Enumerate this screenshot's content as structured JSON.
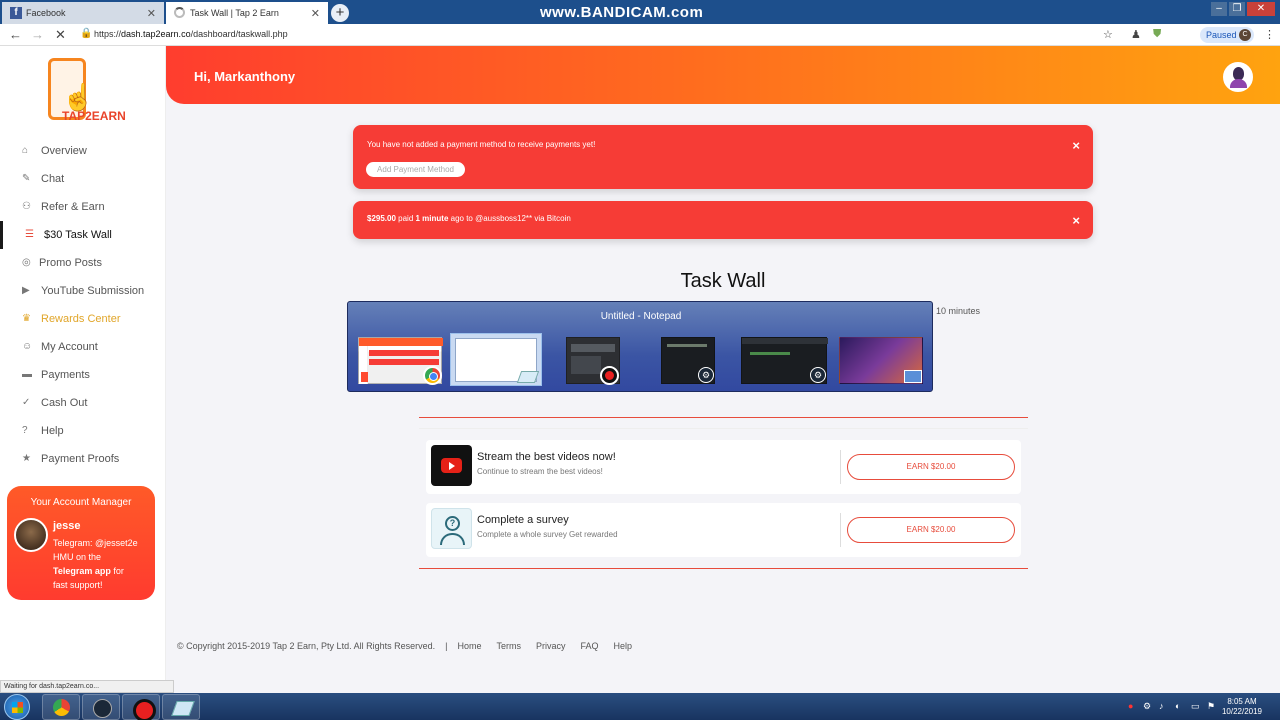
{
  "browser": {
    "tabs": [
      {
        "title": "Facebook"
      },
      {
        "title": "Task Wall | Tap 2 Earn"
      }
    ],
    "new_tab": "+",
    "watermark": "www.BANDICAM.com",
    "url_prefix": "https://",
    "url_host": "dash.tap2earn.co",
    "url_path": "/dashboard/taskwall.php",
    "paused_label": "Paused",
    "profile_initial": "C"
  },
  "sidebar": {
    "logo_text": "TAP2EARN",
    "items": [
      {
        "label": "Overview",
        "icon": "home-icon"
      },
      {
        "label": "Chat",
        "icon": "chat-icon"
      },
      {
        "label": "Refer & Earn",
        "icon": "users-icon"
      },
      {
        "label": "$30 Task Wall",
        "icon": "list-icon"
      },
      {
        "label": "Promo Posts",
        "icon": "instagram-icon"
      },
      {
        "label": "YouTube Submission",
        "icon": "youtube-icon"
      },
      {
        "label": "Rewards Center",
        "icon": "trophy-icon"
      },
      {
        "label": "My Account",
        "icon": "user-icon"
      },
      {
        "label": "Payments",
        "icon": "card-icon"
      },
      {
        "label": "Cash Out",
        "icon": "check-circle-icon"
      },
      {
        "label": "Help",
        "icon": "help-icon"
      },
      {
        "label": "Payment Proofs",
        "icon": "star-icon"
      }
    ],
    "manager": {
      "title": "Your Account Manager",
      "name": "jesse",
      "line1": "Telegram: @jesset2e",
      "line2": "HMU on the",
      "line3_bold": "Telegram app",
      "line3_rest": " for",
      "line4": "fast support!"
    }
  },
  "header": {
    "greeting": "Hi, Markanthony"
  },
  "alerts": {
    "payment_method": {
      "message": "You have not added a payment method to receive payments yet!",
      "button": "Add Payment Method",
      "close": "×"
    },
    "paid": {
      "amount": "$295.00",
      "text1": " paid ",
      "time": "1 minute",
      "text2": " ago to @aussboss12** via Bitcoin",
      "close": "×"
    }
  },
  "main": {
    "title": "Task Wall",
    "subtitle_fragment": "10 minutes",
    "switcher_title": "Untitled - Notepad",
    "tasks": [
      {
        "title": "Stream the best videos now!",
        "desc": "Continue to stream the best videos!",
        "button": "EARN $20.00"
      },
      {
        "title": "Complete a survey",
        "desc": "Complete a whole survey Get rewarded",
        "button": "EARN $20.00"
      }
    ]
  },
  "footer": {
    "copyright": "© Copyright 2015-2019 Tap 2 Earn, Pty Ltd. All Rights Reserved.",
    "separator": "|",
    "links": [
      "Home",
      "Terms",
      "Privacy",
      "FAQ",
      "Help"
    ]
  },
  "status": {
    "text": "Waiting for dash.tap2earn.co..."
  },
  "taskbar": {
    "time": "8:05 AM",
    "date": "10/22/2019"
  },
  "colors": {
    "accent": "#f63c36",
    "header_gradient_start": "#ff3d2e",
    "header_gradient_end": "#ffa30f",
    "rewards_gold": "#e1a62a"
  }
}
